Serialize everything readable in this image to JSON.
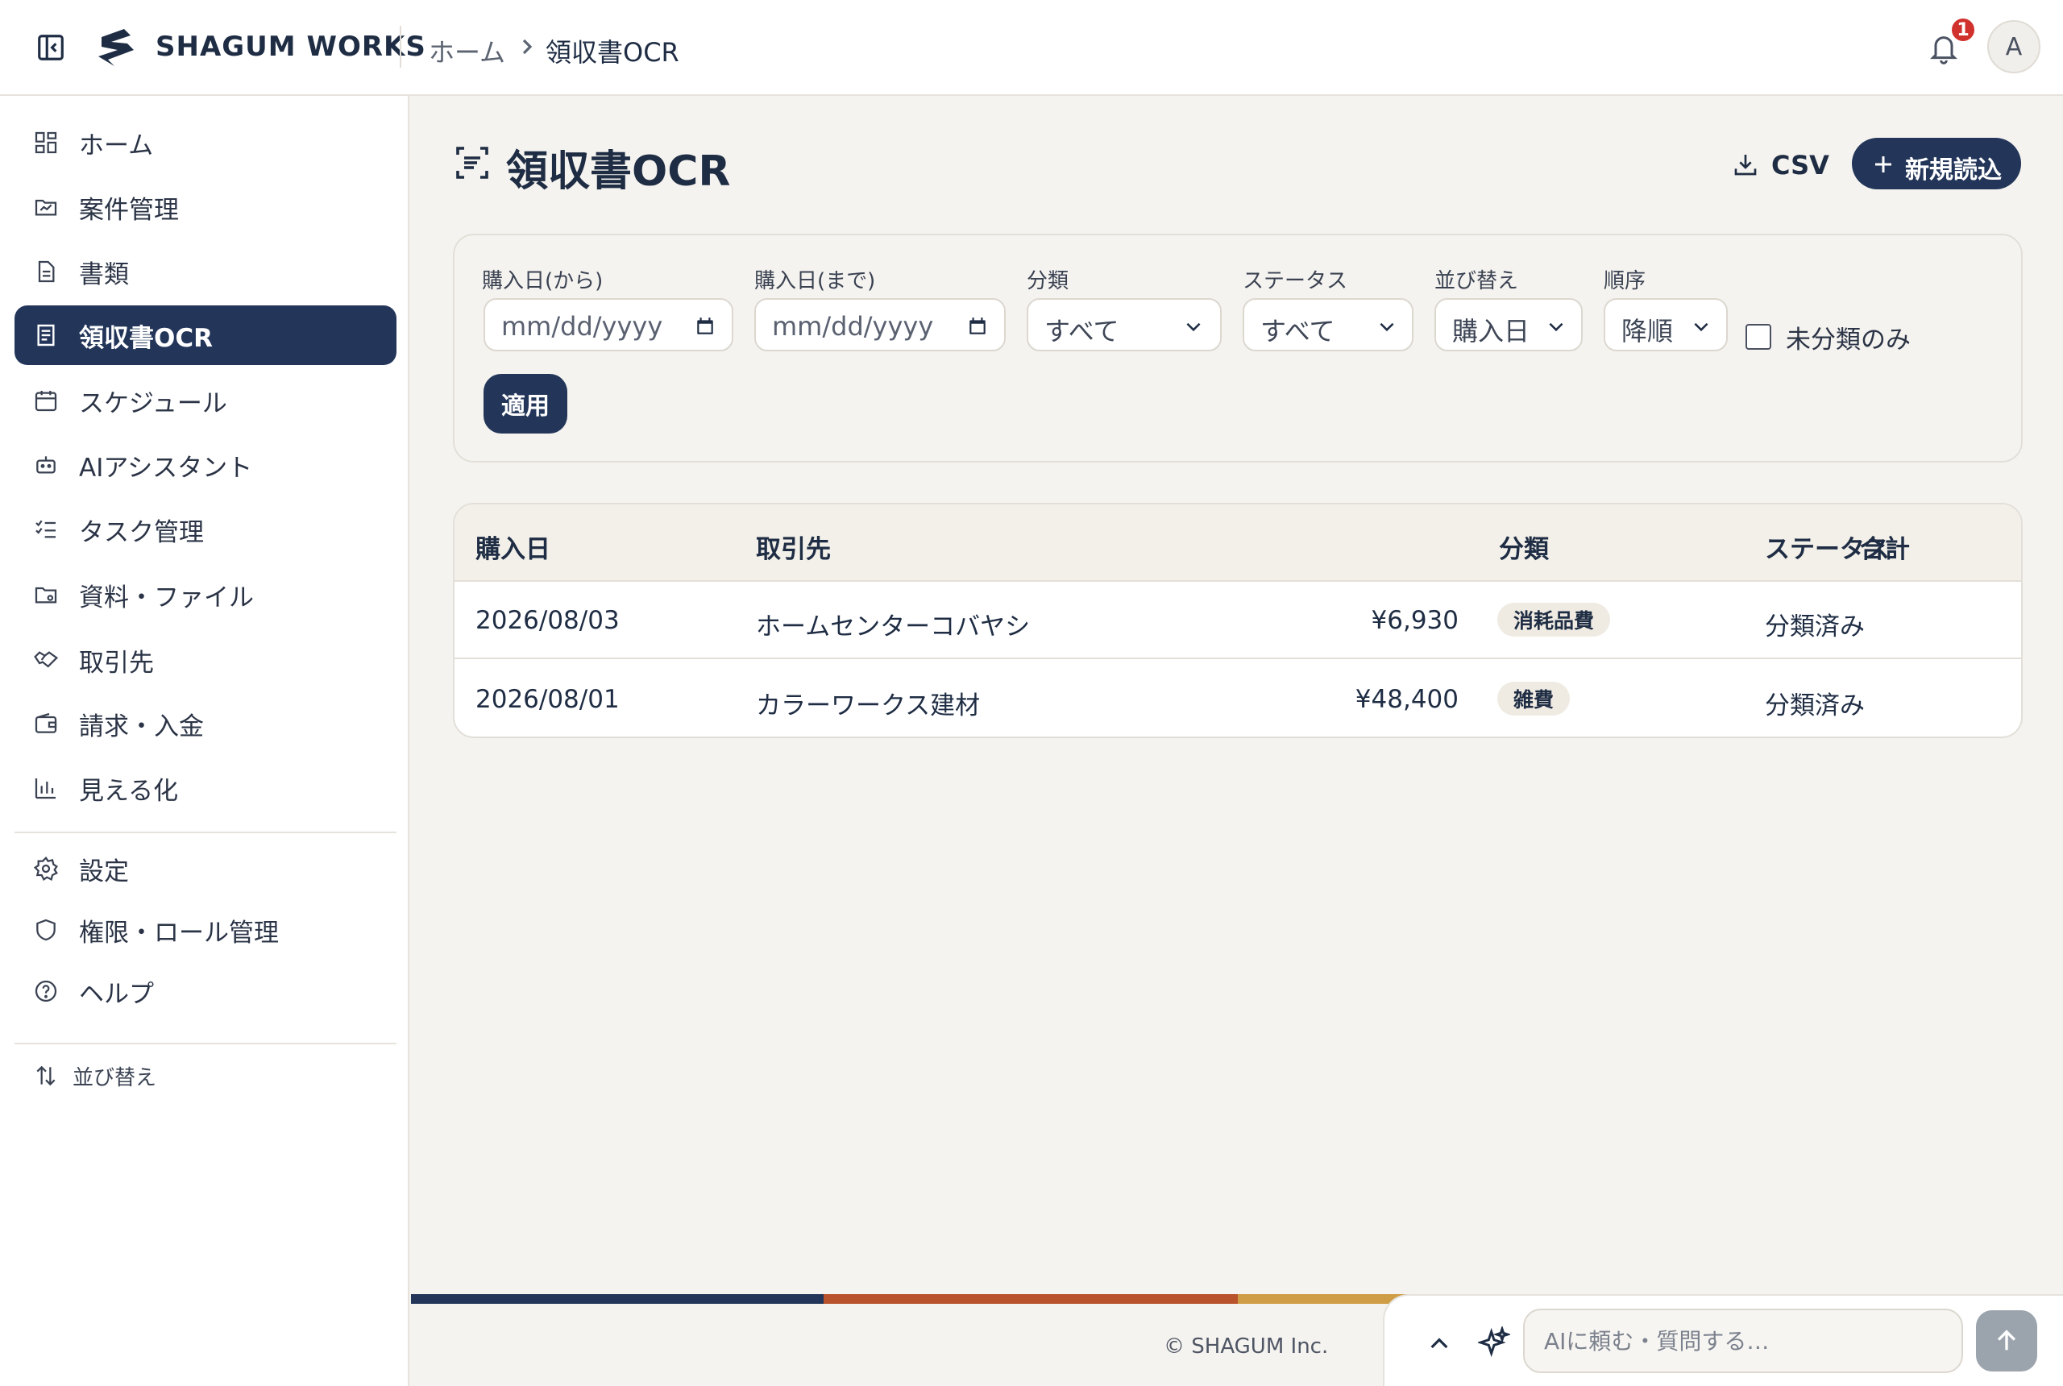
{
  "header": {
    "brand": "SHAGUM WORKS",
    "breadcrumb": {
      "home": "ホーム",
      "current": "領収書OCR"
    },
    "notification_count": "1",
    "avatar_initial": "A"
  },
  "sidebar": {
    "items": [
      {
        "label": "ホーム",
        "icon": "grid-icon"
      },
      {
        "label": "案件管理",
        "icon": "folder-chart-icon"
      },
      {
        "label": "書類",
        "icon": "document-icon"
      },
      {
        "label": "領収書OCR",
        "icon": "receipt-icon",
        "active": true
      },
      {
        "label": "スケジュール",
        "icon": "calendar-icon"
      },
      {
        "label": "AIアシスタント",
        "icon": "bot-icon"
      },
      {
        "label": "タスク管理",
        "icon": "checklist-icon"
      },
      {
        "label": "資料・ファイル",
        "icon": "folder-icon"
      },
      {
        "label": "取引先",
        "icon": "handshake-icon"
      },
      {
        "label": "請求・入金",
        "icon": "wallet-icon"
      },
      {
        "label": "見える化",
        "icon": "bar-chart-icon"
      }
    ],
    "secondary": [
      {
        "label": "設定",
        "icon": "gear-icon"
      },
      {
        "label": "権限・ロール管理",
        "icon": "shield-icon"
      },
      {
        "label": "ヘルプ",
        "icon": "help-icon"
      }
    ],
    "sort_label": "並び替え"
  },
  "page": {
    "title": "領収書OCR",
    "csv_label": "CSV",
    "new_label": "新規読込"
  },
  "filters": {
    "date_from_label": "購入日(から)",
    "date_to_label": "購入日(まで)",
    "date_placeholder": "mm/dd/yyyy",
    "category_label": "分類",
    "category_value": "すべて",
    "status_label": "ステータス",
    "status_value": "すべて",
    "sort_label": "並び替え",
    "sort_value": "購入日",
    "order_label": "順序",
    "order_value": "降順",
    "unclassified_only_label": "未分類のみ",
    "apply_label": "適用"
  },
  "table": {
    "columns": [
      "購入日",
      "取引先",
      "合計",
      "分類",
      "ステータス"
    ],
    "rows": [
      {
        "date": "2026/08/03",
        "vendor": "ホームセンターコバヤシ",
        "total": "¥6,930",
        "category": "消耗品費",
        "status": "分類済み"
      },
      {
        "date": "2026/08/01",
        "vendor": "カラーワークス建材",
        "total": "¥48,400",
        "category": "雑費",
        "status": "分類済み"
      }
    ]
  },
  "footer": {
    "copyright": "© SHAGUM Inc.",
    "stripe_colors": [
      "#23365a",
      "#b9532b",
      "#cf9d45"
    ]
  },
  "ai": {
    "placeholder": "AIに頼む・質問する…"
  },
  "colors": {
    "primary": "#23365a",
    "badge": "#d0312d",
    "background": "#f5f3ef"
  }
}
